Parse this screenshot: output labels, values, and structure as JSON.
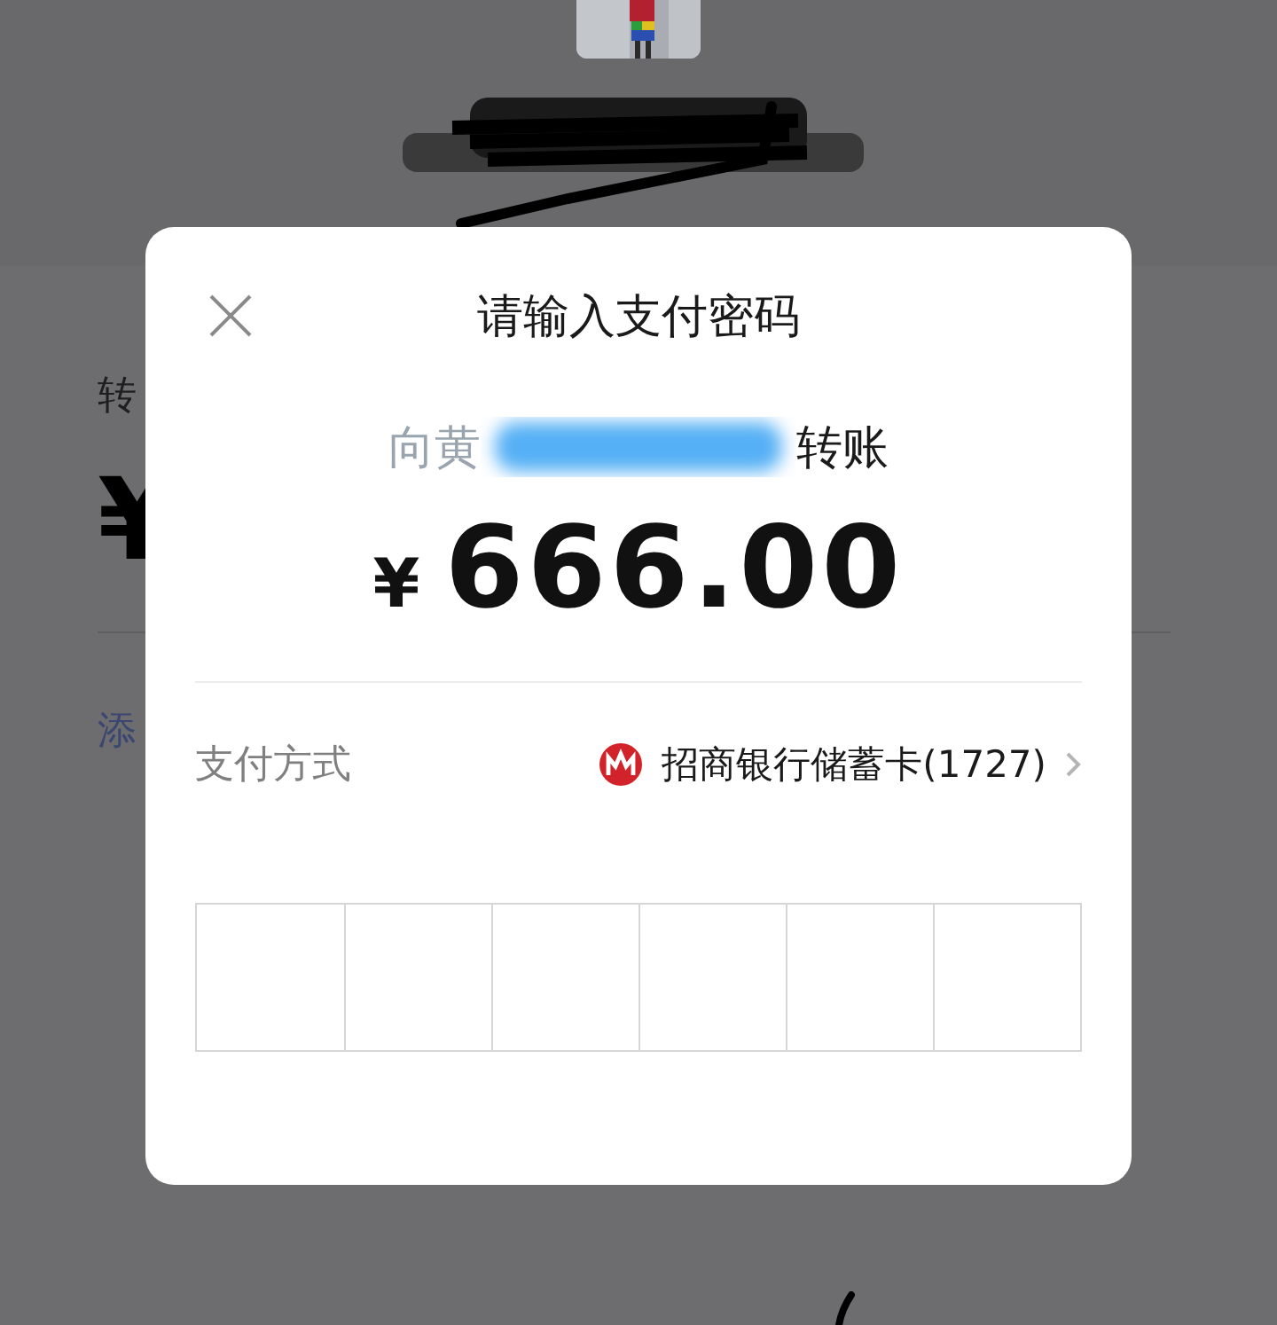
{
  "behind": {
    "caption": "转",
    "currency": "¥",
    "link": "添"
  },
  "dialog": {
    "title": "请输入支付密码",
    "recipient": {
      "prefix": "向黄",
      "suffix": "转账"
    },
    "amount": {
      "currency": "¥",
      "value": "666.00"
    },
    "payment_method": {
      "label": "支付方式",
      "value": "招商银行储蓄卡(1727)"
    },
    "password_cells": [
      {
        "filled": false
      },
      {
        "filled": false
      },
      {
        "filled": false
      },
      {
        "filled": false
      },
      {
        "filled": false
      },
      {
        "filled": false
      }
    ]
  }
}
